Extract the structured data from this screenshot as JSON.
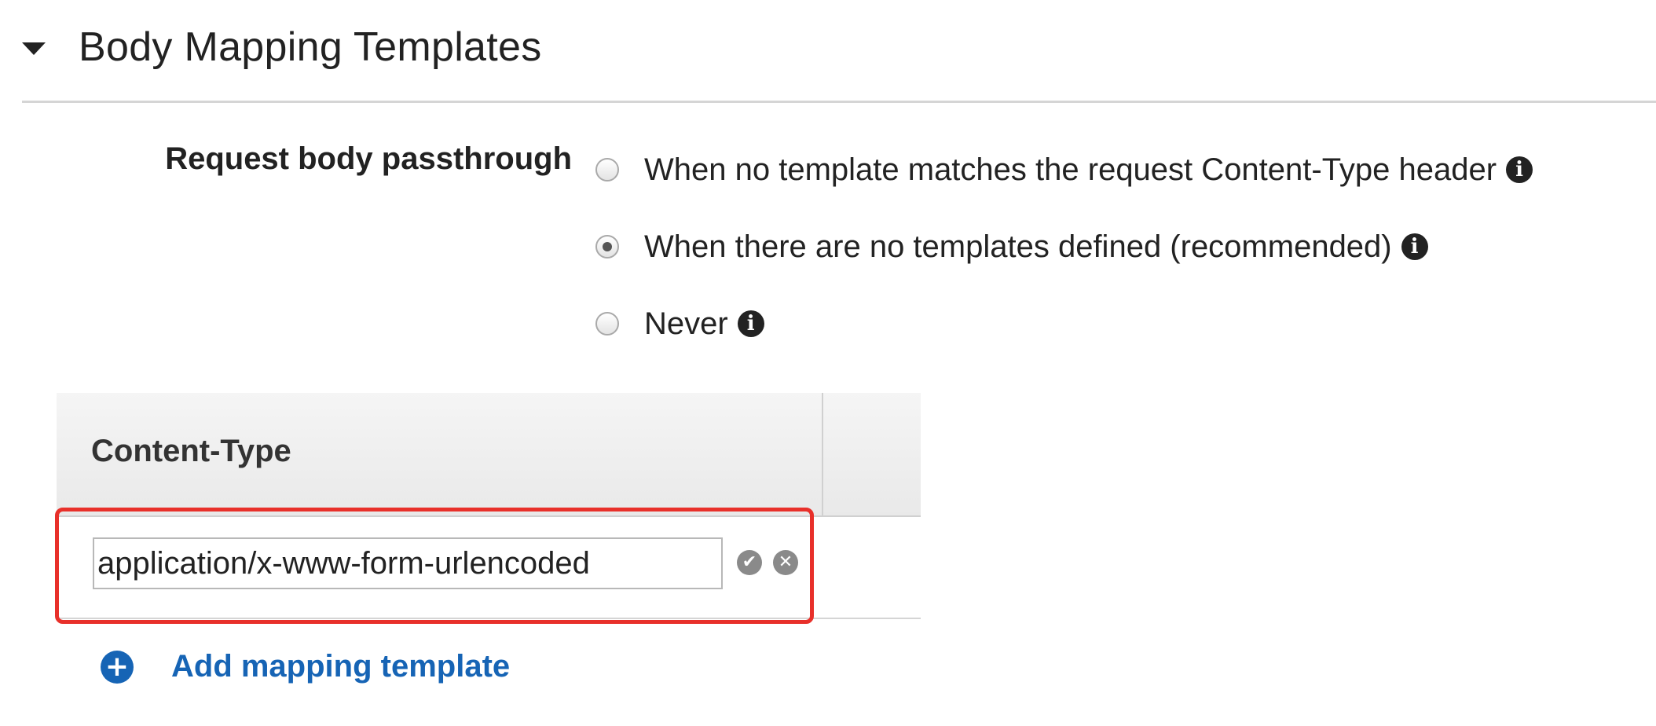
{
  "section": {
    "title": "Body Mapping Templates",
    "caret_icon": "caret-down-icon"
  },
  "passthrough": {
    "label": "Request body passthrough",
    "options": [
      {
        "label": "When no template matches the request Content-Type header",
        "checked": false,
        "info_icon": "info-icon"
      },
      {
        "label": "When there are no templates defined (recommended)",
        "checked": true,
        "info_icon": "info-icon"
      },
      {
        "label": "Never",
        "checked": false,
        "info_icon": "info-icon"
      }
    ]
  },
  "table": {
    "column_header": "Content-Type",
    "rows": [
      {
        "content_type": "application/x-www-form-urlencoded",
        "confirm_icon": "checkmark-icon",
        "cancel_icon": "close-icon"
      }
    ]
  },
  "add_template": {
    "label": "Add mapping template",
    "icon": "plus-circle-icon"
  },
  "colors": {
    "link": "#1664b5",
    "highlight": "#e8302a",
    "text": "#222222"
  }
}
